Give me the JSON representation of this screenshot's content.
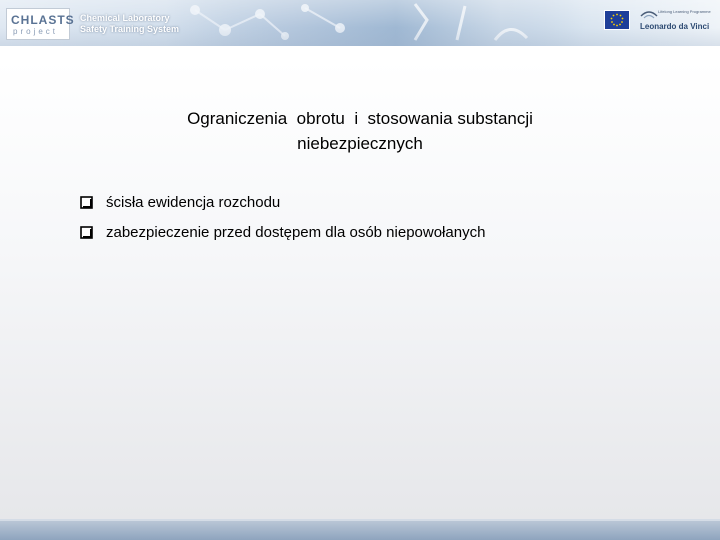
{
  "header": {
    "logo_top": "CHLASTS",
    "logo_bottom": "project",
    "title_line1": "Chemical Laboratory",
    "title_line2": "Safety Training System",
    "eu_flag_icon": "eu-flag-icon",
    "programme_small": "Lifelong Learning Programme",
    "programme_name": "Leonardo da Vinci"
  },
  "slide": {
    "title_line1": "Ograniczenia  obrotu  i  stosowania substancji",
    "title_line2": "niebezpiecznych",
    "bullets": [
      "ścisła ewidencja rozchodu",
      "zabezpieczenie przed dostępem dla osób niepowołanych"
    ],
    "bullet_icon": "checkbox-square-icon"
  },
  "colors": {
    "banner": "#c9d8e8",
    "accent": "#5a7394",
    "bottom_bar": "#8ea4be"
  }
}
